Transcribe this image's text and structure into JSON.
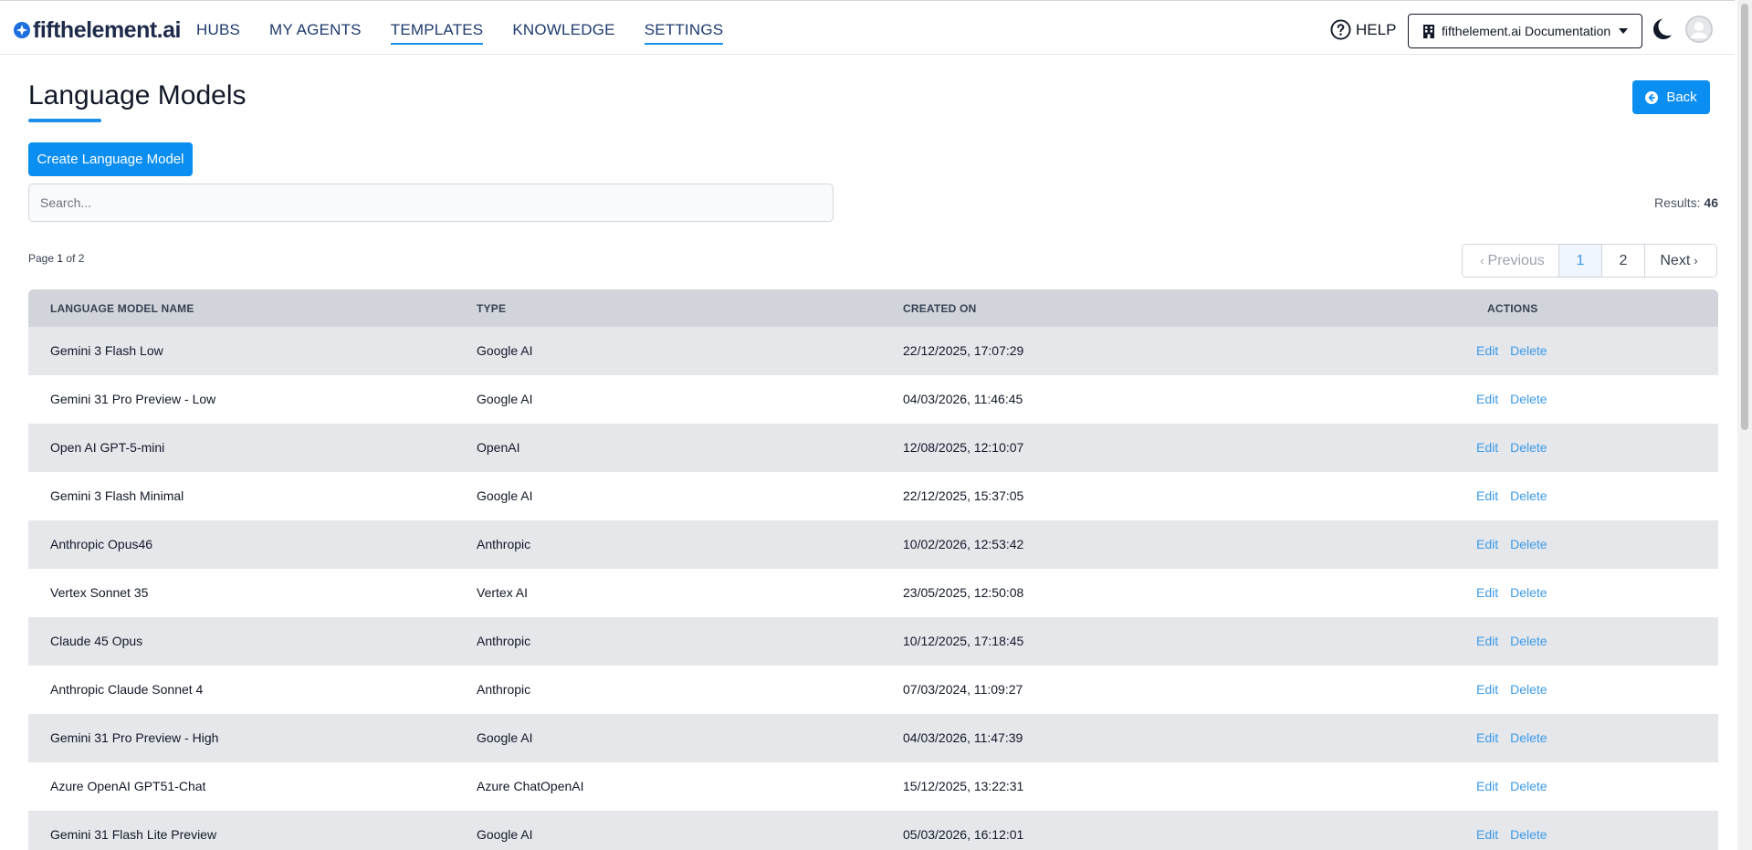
{
  "brand": {
    "name": "fifthelement.ai"
  },
  "nav": {
    "items": [
      {
        "label": "HUBS",
        "active": false
      },
      {
        "label": "MY AGENTS",
        "active": false
      },
      {
        "label": "TEMPLATES",
        "active": true
      },
      {
        "label": "KNOWLEDGE",
        "active": false
      },
      {
        "label": "SETTINGS",
        "active": true
      }
    ]
  },
  "header": {
    "help_label": "HELP",
    "org_label": "fifthelement.ai Documentation"
  },
  "page": {
    "title": "Language Models",
    "back_label": "Back",
    "create_label": "Create Language Model",
    "search_placeholder": "Search...",
    "results_label": "Results:",
    "results_count": "46",
    "page_label": "Page",
    "page_current": "1",
    "page_of": "of",
    "page_total": "2"
  },
  "pagination": {
    "previous": "Previous",
    "pages": [
      "1",
      "2"
    ],
    "next": "Next"
  },
  "table": {
    "columns": [
      "LANGUAGE MODEL NAME",
      "TYPE",
      "CREATED ON",
      "ACTIONS"
    ],
    "edit_label": "Edit",
    "delete_label": "Delete",
    "rows": [
      {
        "name": "Gemini 3 Flash Low",
        "type": "Google AI",
        "created": "22/12/2025, 17:07:29"
      },
      {
        "name": "Gemini 31 Pro Preview - Low",
        "type": "Google AI",
        "created": "04/03/2026, 11:46:45"
      },
      {
        "name": "Open AI GPT-5-mini",
        "type": "OpenAI",
        "created": "12/08/2025, 12:10:07"
      },
      {
        "name": "Gemini 3 Flash Minimal",
        "type": "Google AI",
        "created": "22/12/2025, 15:37:05"
      },
      {
        "name": "Anthropic Opus46",
        "type": "Anthropic",
        "created": "10/02/2026, 12:53:42"
      },
      {
        "name": "Vertex Sonnet 35",
        "type": "Vertex AI",
        "created": "23/05/2025, 12:50:08"
      },
      {
        "name": "Claude 45 Opus",
        "type": "Anthropic",
        "created": "10/12/2025, 17:18:45"
      },
      {
        "name": "Anthropic Claude Sonnet 4",
        "type": "Anthropic",
        "created": "07/03/2024, 11:09:27"
      },
      {
        "name": "Gemini 31 Pro Preview - High",
        "type": "Google AI",
        "created": "04/03/2026, 11:47:39"
      },
      {
        "name": "Azure OpenAI GPT51-Chat",
        "type": "Azure ChatOpenAI",
        "created": "15/12/2025, 13:22:31"
      },
      {
        "name": "Gemini 31 Flash Lite Preview",
        "type": "Google AI",
        "created": "05/03/2026, 16:12:01"
      }
    ]
  },
  "colors": {
    "accent": "#0b8ef1",
    "nav_text": "#1e3a6e",
    "link": "#3b9ae8"
  }
}
